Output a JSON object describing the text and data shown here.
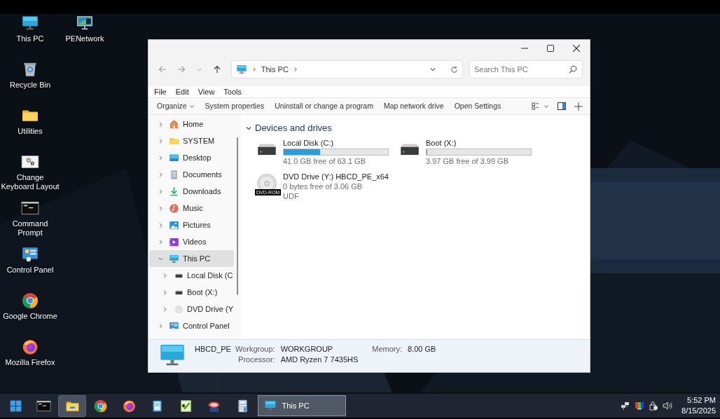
{
  "desktop_icons": [
    {
      "kind": "monitor",
      "label": "This PC"
    },
    {
      "kind": "network",
      "label": "PENetwork"
    },
    {
      "kind": "recycle",
      "label": "Recycle Bin"
    },
    {
      "kind": "folder",
      "label": "Utilities"
    },
    {
      "kind": "settings",
      "label": "Change Keyboard Layout"
    },
    {
      "kind": "terminal",
      "label": "Command Prompt"
    },
    {
      "kind": "panel",
      "label": "Control Panel"
    },
    {
      "kind": "chrome",
      "label": "Google Chrome"
    },
    {
      "kind": "firefox",
      "label": "Mozilla Firefox"
    }
  ],
  "window": {
    "address": {
      "path": [
        "This PC"
      ]
    },
    "search": {
      "placeholder": "Search This PC"
    },
    "menu": [
      "File",
      "Edit",
      "View",
      "Tools"
    ],
    "commands": [
      {
        "label": "Organize",
        "dropdown": true
      },
      {
        "label": "System properties",
        "dropdown": false
      },
      {
        "label": "Uninstall or change a program",
        "dropdown": false
      },
      {
        "label": "Map network drive",
        "dropdown": false
      },
      {
        "label": "Open Settings",
        "dropdown": false
      }
    ],
    "nav": [
      {
        "kind": "home",
        "label": "Home",
        "selected": false,
        "expanded": false
      },
      {
        "kind": "folder",
        "label": "SYSTEM",
        "selected": false,
        "expanded": false
      },
      {
        "kind": "desktop",
        "label": "Desktop",
        "selected": false,
        "expanded": false
      },
      {
        "kind": "documents",
        "label": "Documents",
        "selected": false,
        "expanded": false
      },
      {
        "kind": "downloads",
        "label": "Downloads",
        "selected": false,
        "expanded": false
      },
      {
        "kind": "music",
        "label": "Music",
        "selected": false,
        "expanded": false
      },
      {
        "kind": "pictures",
        "label": "Pictures",
        "selected": false,
        "expanded": false
      },
      {
        "kind": "videos",
        "label": "Videos",
        "selected": false,
        "expanded": false
      },
      {
        "kind": "monitor",
        "label": "This PC",
        "selected": true,
        "expanded": true,
        "children": [
          {
            "kind": "disk",
            "label": "Local Disk (C",
            "selected": false,
            "expanded": false
          },
          {
            "kind": "disk",
            "label": "Boot (X:)",
            "selected": false,
            "expanded": false
          },
          {
            "kind": "dvd",
            "label": "DVD Drive (Y",
            "selected": false,
            "expanded": false
          }
        ]
      },
      {
        "kind": "panel",
        "label": "Control Panel",
        "selected": false,
        "expanded": false
      }
    ],
    "section": {
      "title": "Devices and drives",
      "expanded": true
    },
    "drives": [
      {
        "kind": "disk",
        "name": "Local Disk (C:)",
        "level": 0.35,
        "free": "41.0 GB free of 63.1 GB"
      },
      {
        "kind": "disk",
        "name": "Boot (X:)",
        "level": 0.005,
        "free": "3.97 GB free of 3.99 GB"
      },
      {
        "kind": "dvd",
        "name": "DVD Drive (Y:) HBCD_PE_x64",
        "badge": "DVD-ROM",
        "free": "0 bytes free of 3.06 GB",
        "filesystem": "UDF"
      }
    ],
    "details": {
      "name": "HBCD_PE",
      "rows": [
        [
          {
            "label": "Workgroup:",
            "value": "WORKGROUP"
          },
          {
            "label": "Memory:",
            "value": "8.00 GB"
          }
        ],
        [
          {
            "label": "Processor:",
            "value": "AMD Ryzen 7 7435HS"
          }
        ]
      ]
    }
  },
  "taskbar": {
    "apps": [
      {
        "kind": "start",
        "selected": false
      },
      {
        "kind": "terminal",
        "selected": false
      },
      {
        "kind": "explorer",
        "selected": true
      },
      {
        "kind": "chrome",
        "selected": false
      },
      {
        "kind": "firefox",
        "selected": false
      },
      {
        "kind": "notepad",
        "selected": false
      },
      {
        "kind": "editor",
        "selected": false
      },
      {
        "kind": "snip",
        "selected": false
      },
      {
        "kind": "calc",
        "selected": false
      }
    ],
    "windows": [
      {
        "kind": "monitor",
        "label": "This PC",
        "selected": true
      }
    ],
    "clock": {
      "time": "5:52 PM",
      "date": "8/15/2025"
    }
  }
}
